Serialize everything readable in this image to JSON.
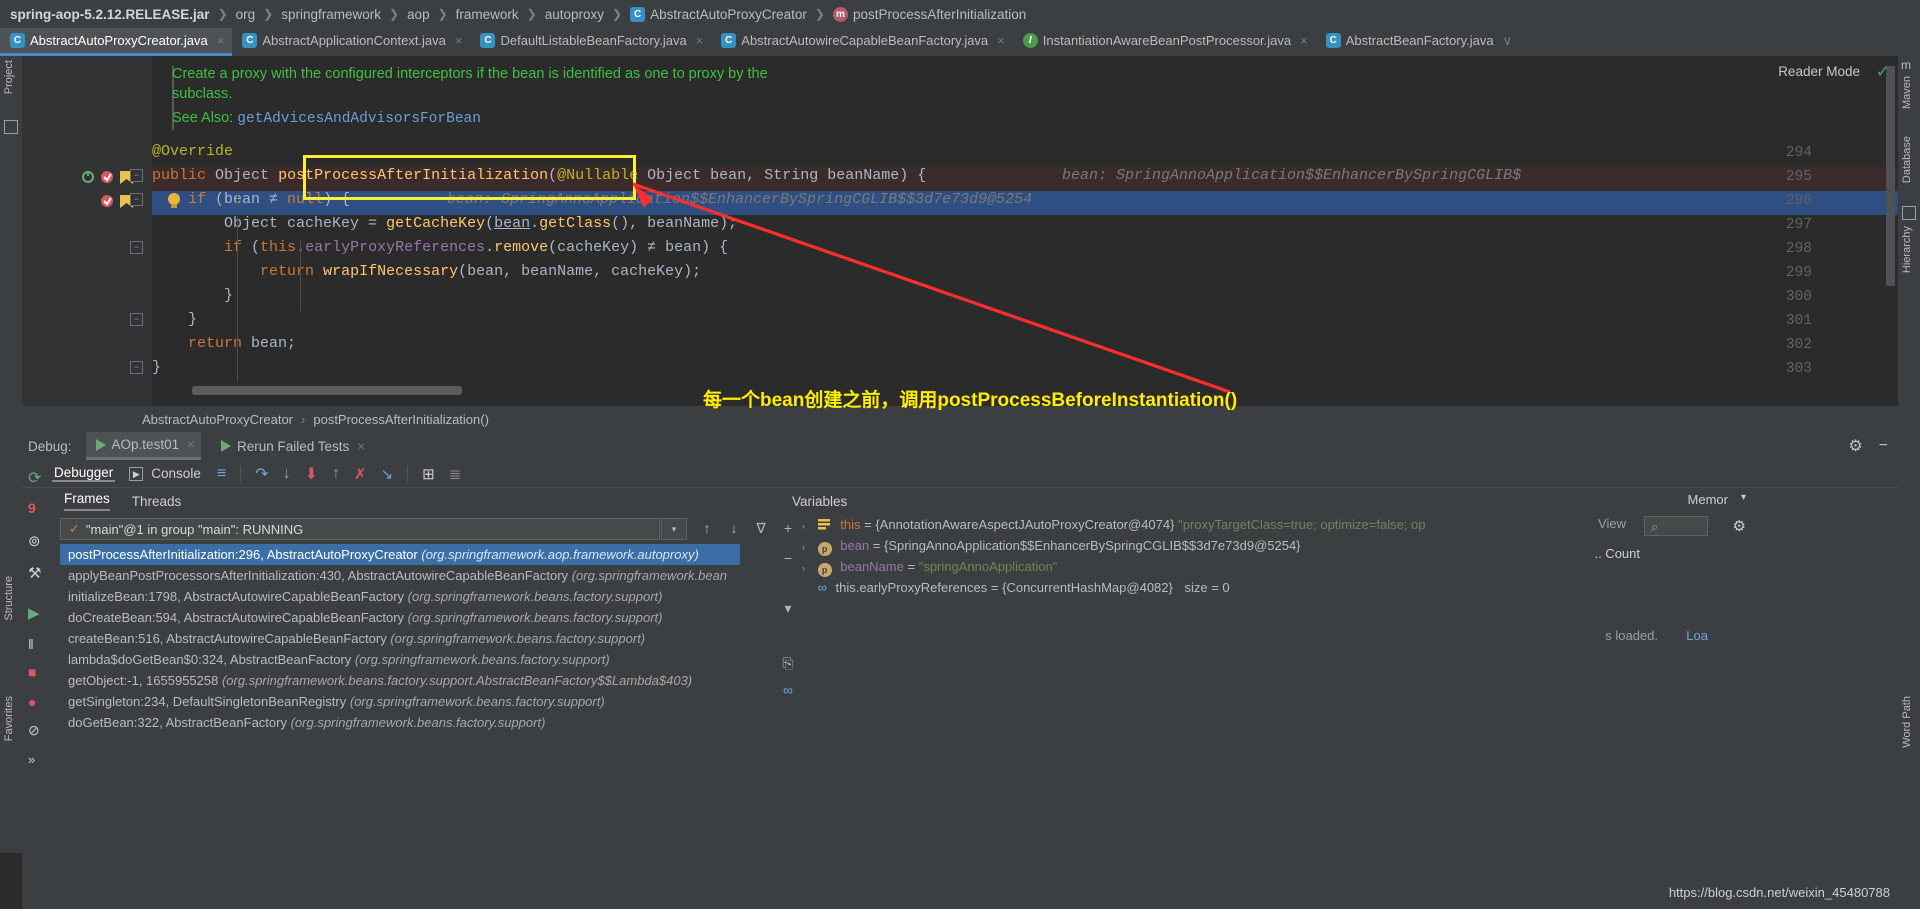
{
  "colors": {
    "bg": "#2b2b2b",
    "panel": "#3c3f41",
    "accent": "#4a88c7",
    "selection": "#3a6ea5",
    "exec_line": "#2f4f82",
    "method_line": "#3c2b2b",
    "annotation_yellow": "#ffef2e",
    "arrow_red": "#ff2d2d",
    "javadoc_green": "#3dc23d"
  },
  "breadcrumbs": [
    {
      "label": "spring-aop-5.2.12.RELEASE.jar",
      "icon": "",
      "bold": true
    },
    {
      "label": "org",
      "icon": ""
    },
    {
      "label": "springframework",
      "icon": ""
    },
    {
      "label": "aop",
      "icon": ""
    },
    {
      "label": "framework",
      "icon": ""
    },
    {
      "label": "autoproxy",
      "icon": ""
    },
    {
      "label": "AbstractAutoProxyCreator",
      "icon": "class-icon"
    },
    {
      "label": "postProcessAfterInitialization",
      "icon": "method-icon"
    }
  ],
  "editor_tabs": [
    {
      "label": "AbstractAutoProxyCreator.java",
      "icon": "class-icon",
      "active": true,
      "close": "×"
    },
    {
      "label": "AbstractApplicationContext.java",
      "icon": "class-icon",
      "active": false,
      "close": "×"
    },
    {
      "label": "DefaultListableBeanFactory.java",
      "icon": "class-icon",
      "active": false,
      "close": "×"
    },
    {
      "label": "AbstractAutowireCapableBeanFactory.java",
      "icon": "class-icon",
      "active": false,
      "close": "×"
    },
    {
      "label": "InstantiationAwareBeanPostProcessor.java",
      "icon": "interface-icon",
      "active": false,
      "close": "×"
    },
    {
      "label": "AbstractBeanFactory.java",
      "icon": "class-icon",
      "active": false,
      "close": "×"
    }
  ],
  "tabs_overflow_chevron": "∨",
  "left_strip": [
    {
      "label": "Project"
    },
    {
      "label": "Structure"
    },
    {
      "label": "Favorites"
    }
  ],
  "right_strip": [
    {
      "label": "Maven"
    },
    {
      "label": "Database"
    },
    {
      "label": "Hierarchy"
    },
    {
      "label": "Word Path"
    }
  ],
  "reader_mode": {
    "label": "Reader Mode",
    "check": "✓"
  },
  "javadoc": {
    "paragraph": "Create a proxy with the configured interceptors if the bean is identified as one to proxy by the subclass.",
    "see_also_label": "See Also:",
    "see_also_link": "getAdvicesAndAdvisorsForBean"
  },
  "code": {
    "line_numbers": [
      "294",
      "295",
      "296",
      "297",
      "298",
      "299",
      "300",
      "301",
      "302",
      "303"
    ],
    "lines": [
      "@Override",
      "public Object postProcessAfterInitialization(@Nullable Object bean, String beanName) {",
      "    if (bean ≠ null) {",
      "        Object cacheKey = getCacheKey(bean.getClass(), beanName);",
      "        if (this.earlyProxyReferences.remove(cacheKey) ≠ bean) {",
      "            return wrapIfNecessary(bean, beanName, cacheKey);",
      "        }",
      "    }",
      "    return bean;",
      "}"
    ],
    "inline_hint_295": "bean: SpringAnnoApplication$$EnhancerBySpringCGLIB$",
    "inline_hint_296": "bean: SpringAnnoApplication$$EnhancerBySpringCGLIB$$3d7e73d9@5254"
  },
  "annotation": {
    "highlight_target": "postProcessAfterInitialization(",
    "note_text": "每一个bean创建之前，调用postProcessBeforeInstantiation()"
  },
  "navbar": {
    "class": "AbstractAutoProxyCreator",
    "separator": "›",
    "method": "postProcessAfterInitialization()"
  },
  "debug": {
    "label": "Debug:",
    "run_tabs": [
      {
        "label": "AOp.test01",
        "selected": true,
        "close": "×"
      },
      {
        "label": "Rerun Failed Tests",
        "selected": false,
        "close": "×"
      }
    ],
    "header_icons": [
      {
        "name": "settings-icon",
        "glyph": "⚙"
      },
      {
        "name": "minimize-icon",
        "glyph": "−"
      }
    ],
    "toolbar_tabs": [
      {
        "label": "Debugger",
        "selected": true
      },
      {
        "label": "Console",
        "selected": false
      }
    ],
    "toolbar_icons": [
      {
        "name": "show-frames-icon",
        "glyph": "≡"
      },
      {
        "name": "step-over-icon",
        "glyph": "↷"
      },
      {
        "name": "step-into-icon",
        "glyph": "↓"
      },
      {
        "name": "force-step-into-icon",
        "glyph": "⬇"
      },
      {
        "name": "step-out-icon",
        "glyph": "↑"
      },
      {
        "name": "drop-frame-icon",
        "glyph": "✗"
      },
      {
        "name": "run-to-cursor-icon",
        "glyph": "↘"
      },
      {
        "name": "evaluate-expression-icon",
        "glyph": "⊞"
      },
      {
        "name": "mute-breakpoints-icon",
        "glyph": "≣"
      }
    ],
    "rail_icons": [
      {
        "name": "rerun-icon",
        "glyph": "⟳"
      },
      {
        "name": "breakpoints-count-icon",
        "glyph": "9"
      },
      {
        "name": "restore-layout-icon",
        "glyph": "⊚"
      },
      {
        "name": "settings-wrench-icon",
        "glyph": "⚒"
      },
      {
        "name": "resume-program-icon",
        "glyph": "▶"
      },
      {
        "name": "pause-program-icon",
        "glyph": "‖"
      },
      {
        "name": "stop-icon",
        "glyph": "■"
      },
      {
        "name": "view-breakpoints-icon",
        "glyph": "●"
      },
      {
        "name": "mute-breakpoints-rail-icon",
        "glyph": "⊘"
      },
      {
        "name": "more-icon",
        "glyph": "»"
      }
    ],
    "frames_tabs": [
      {
        "label": "Frames",
        "selected": true
      },
      {
        "label": "Threads",
        "selected": false
      }
    ],
    "thread_selector": {
      "check": "✓",
      "value": "\"main\"@1 in group \"main\": RUNNING",
      "chevron": "▾"
    },
    "stack_buttons": [
      {
        "name": "move-up-icon",
        "glyph": "↑"
      },
      {
        "name": "move-down-icon",
        "glyph": "↓"
      },
      {
        "name": "filter-frames-icon",
        "glyph": "∇"
      },
      {
        "name": "add-icon",
        "glyph": "+"
      },
      {
        "name": "remove-icon",
        "glyph": "−"
      },
      {
        "name": "collapse-icon",
        "glyph": "▾"
      },
      {
        "name": "copy-stack-icon",
        "glyph": "⎘"
      },
      {
        "name": "watches-icon",
        "glyph": "∞"
      }
    ],
    "stack_frames": [
      {
        "method": "postProcessAfterInitialization:296, AbstractAutoProxyCreator",
        "package": "(org.springframework.aop.framework.autoproxy)",
        "selected": true
      },
      {
        "method": "applyBeanPostProcessorsAfterInitialization:430, AbstractAutowireCapableBeanFactory",
        "package": "(org.springframework.bean",
        "selected": false
      },
      {
        "method": "initializeBean:1798, AbstractAutowireCapableBeanFactory",
        "package": "(org.springframework.beans.factory.support)",
        "selected": false
      },
      {
        "method": "doCreateBean:594, AbstractAutowireCapableBeanFactory",
        "package": "(org.springframework.beans.factory.support)",
        "selected": false
      },
      {
        "method": "createBean:516, AbstractAutowireCapableBeanFactory",
        "package": "(org.springframework.beans.factory.support)",
        "selected": false
      },
      {
        "method": "lambda$doGetBean$0:324, AbstractBeanFactory",
        "package": "(org.springframework.beans.factory.support)",
        "selected": false
      },
      {
        "method": "getObject:-1, 1655955258",
        "package": "(org.springframework.beans.factory.support.AbstractBeanFactory$$Lambda$403)",
        "selected": false
      },
      {
        "method": "getSingleton:234, DefaultSingletonBeanRegistry",
        "package": "(org.springframework.beans.factory.support)",
        "selected": false
      },
      {
        "method": "doGetBean:322, AbstractBeanFactory",
        "package": "(org.springframework.beans.factory.support)",
        "selected": false
      }
    ],
    "variables_header": "Variables",
    "variables": [
      {
        "arrow": "›",
        "icon": "this-icon",
        "name": "this",
        "eq": "=",
        "value": "{AnnotationAwareAspectJAutoProxyCreator@4074}",
        "string_value": "\"proxyTargetClass=true; optimize=false; op",
        "trailing": ""
      },
      {
        "arrow": "›",
        "icon": "object-icon",
        "name": "bean",
        "eq": "=",
        "value": "{SpringAnnoApplication$$EnhancerBySpringCGLIB$$3d7e73d9@5254}",
        "string_value": "",
        "trailing": ""
      },
      {
        "arrow": "›",
        "icon": "object-icon",
        "name": "beanName",
        "eq": "=",
        "value": "",
        "string_value": "\"springAnnoApplication\"",
        "trailing": ""
      },
      {
        "arrow": "",
        "icon": "watch-icon",
        "name": "this.earlyProxyReferences",
        "eq": "=",
        "value": "{ConcurrentHashMap@4082}",
        "string_value": "",
        "trailing": "size = 0"
      }
    ],
    "variables_right": {
      "memory_label": "Memor",
      "memory_chevron": "▾",
      "view_label": "View",
      "search_icon": "⌕",
      "settings_icon": "⚙",
      "count_label": ".. Count",
      "loaded_label": "s loaded.",
      "loa_label": "Loa"
    }
  },
  "watermark": "https://blog.csdn.net/weixin_45480788"
}
